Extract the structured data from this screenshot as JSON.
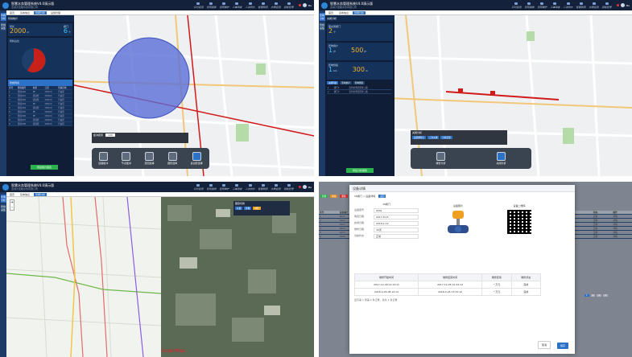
{
  "app": {
    "title": "智慧水务管理系统V4.0演示版",
    "subtitle": "宽城大佳瞻水务有限公司",
    "user": "Ma"
  },
  "nav": [
    "实时监测",
    "管网漏损",
    "管网维护",
    "工单派发",
    "二次供水",
    "智慧热网",
    "水质监测",
    "巡检管理",
    "统计报表"
  ],
  "side": [
    "管网分析",
    "管线采集"
  ],
  "q1": {
    "tabs": [
      "首页",
      "基本信息",
      "管网分析",
      "设施管理"
    ],
    "panel_title": "管线统计",
    "stat1_label": "管长",
    "stat1_value": "2000",
    "stat1_unit": "m",
    "stat2_label": "阀门",
    "stat2_value": "6",
    "stat2_unit": "个",
    "chart_title": "管材占比",
    "pie_colors": [
      "#c8211a",
      "#1f3f6b"
    ],
    "list_title": "管线列表",
    "table_head": [
      "序号",
      "管段编号",
      "材质",
      "口径",
      "所属区域"
    ],
    "table_rows": [
      [
        "1",
        "管段000",
        "PE",
        "DN110",
        "行政区"
      ],
      [
        "2",
        "管段001",
        "铸铁管",
        "DN160",
        "行政区"
      ],
      [
        "3",
        "管段002",
        "铸铁管",
        "DN110",
        "行政区"
      ],
      [
        "4",
        "管段003",
        "PE",
        "DN110",
        "行政区"
      ],
      [
        "5",
        "管段004",
        "铸铁管",
        "DN110",
        "行政区"
      ],
      [
        "6",
        "管段005",
        "PE",
        "DN160",
        "行政区"
      ],
      [
        "7",
        "管段006",
        "PE",
        "DN110",
        "行政区"
      ],
      [
        "8",
        "管段007",
        "铸铁管",
        "DN160",
        "行政区"
      ],
      [
        "9",
        "管段008",
        "铸铁管",
        "DN110",
        "行政区"
      ]
    ],
    "export_btn": "导出统计报表",
    "radius_label": "缓冲距离",
    "radius_value": "100",
    "tools": [
      "道路缓冲",
      "节点缓冲",
      "范围选择",
      "圆形选择",
      "多边形选择"
    ]
  },
  "q2": {
    "tabs": [
      "首页",
      "基本信息",
      "管网分析"
    ],
    "panel_title": "关阀分析",
    "card1_label": "需关闭阀门",
    "card1_value": "2",
    "card1_unit": "个",
    "card2_label": "影响用户",
    "card2_value": "1",
    "card2_unit": "户",
    "card2b_value": "500",
    "card2b_unit": "户",
    "card3_label": "影响管段",
    "card3_value": "1",
    "card3_unit": "km",
    "card3b_value": "300",
    "card3b_unit": "m",
    "list_tabs": [
      "关阀列表",
      "影响用户",
      "影响管段"
    ],
    "rows": [
      [
        "1",
        "阀门1",
        "宝鸡市渭滨区经二路"
      ],
      [
        "2",
        "阀门2",
        "宝鸡市渭滨区经二路"
      ]
    ],
    "export_btn": "导出分析报告",
    "bar_label": "关阀分析",
    "bar_pills": [
      "设置爆管点",
      "二次关阀",
      "分析结果"
    ],
    "tools": [
      "爆管分析",
      "关阀分析"
    ]
  },
  "q3": {
    "tabs": [
      "首页",
      "基本信息",
      "管网分析"
    ],
    "layer_title": "图层切换",
    "layer_opts": [
      "矢量",
      "影像",
      "地形"
    ],
    "watermark": "SuperMap",
    "zoom": [
      "+",
      "-"
    ]
  },
  "q4": {
    "tabs": [
      "首页",
      "基本信息",
      "设施管理"
    ],
    "toolbar": [
      "新增",
      "修改",
      "删除",
      "导出"
    ],
    "modal_title": "设备详情",
    "breadcrumb": "16阀门 > 设备详情",
    "return_btn": "返回",
    "section_title": "16阀门",
    "fields": [
      [
        "设备型号",
        "0001"
      ],
      [
        "购置日期",
        "2017-8-15"
      ],
      [
        "启用日期",
        "2018-1-12"
      ],
      [
        "维修日期",
        "30天"
      ],
      [
        "当前状态",
        "正常"
      ]
    ],
    "photo_label": "设备照片",
    "qr_label": "设备二维码",
    "record_head": [
      "维修开始时间",
      "维修结束时间",
      "维修费用",
      "维修状态"
    ],
    "records": [
      [
        "2017-12-28 01:33:11",
        "2017-12-28 12:33:12",
        "一万元",
        "完成"
      ],
      [
        "2018-4-26 08:12:12",
        "2018-4-26 13:33:12",
        "一万元",
        "完成"
      ]
    ],
    "pager": "显示第 1 到第 2 条记录，总共 2 条记录",
    "cancel_btn": "取消",
    "ok_btn": "保存",
    "bg_head": [
      "序号",
      "设备编号",
      "设备名称",
      "型号",
      "购置日期",
      "启用日期",
      "生产厂家",
      "维修日期",
      "状态",
      "操作"
    ],
    "bg_rows": [
      [
        "1",
        "0001",
        "阀门",
        "DN110",
        "2017-8-15",
        "2018-1-12",
        "厂家A",
        "30天",
        "正常",
        "详情"
      ],
      [
        "2",
        "0002",
        "阀门",
        "DN160",
        "2017-8-15",
        "2018-1-12",
        "厂家A",
        "30天",
        "正常",
        "详情"
      ],
      [
        "3",
        "0003",
        "阀门",
        "DN110",
        "2017-8-15",
        "2018-1-12",
        "厂家A",
        "30天",
        "正常",
        "详情"
      ],
      [
        "4",
        "0004",
        "消防栓",
        "DN110",
        "2017-8-15",
        "2018-1-12",
        "厂家A",
        "30天",
        "正常",
        "详情"
      ],
      [
        "5",
        "0005",
        "阀门",
        "DN160",
        "2017-8-15",
        "2018-1-12",
        "厂家A",
        "30天",
        "正常",
        "详情"
      ],
      [
        "6",
        "0006",
        "阀门",
        "DN110",
        "2017-8-15",
        "2018-1-12",
        "厂家A",
        "30天",
        "正常",
        "详情"
      ]
    ],
    "pages": [
      "1",
      "2",
      "3",
      "4"
    ]
  }
}
